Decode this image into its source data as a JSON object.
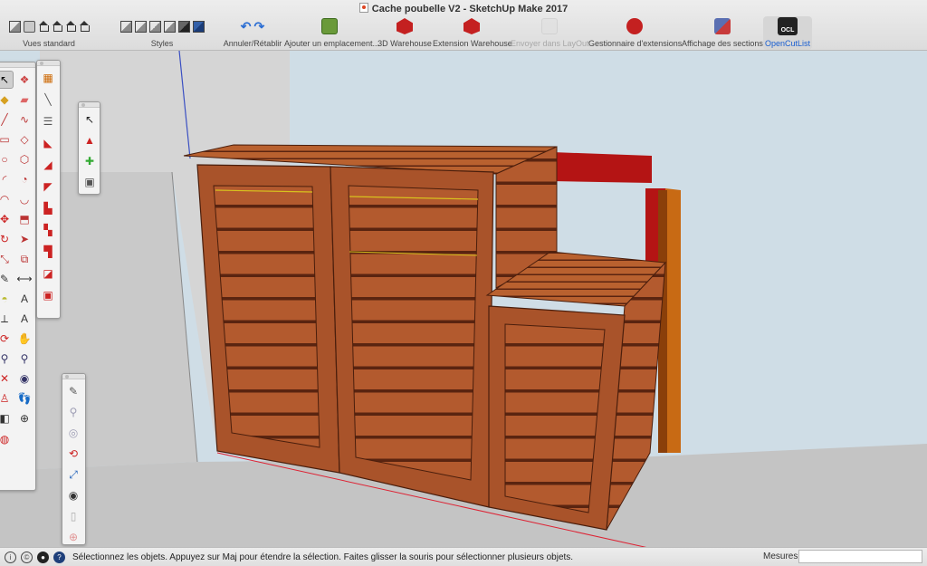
{
  "window": {
    "title": "Cache poubelle V2 - SketchUp Make 2017"
  },
  "toolbar": {
    "groups": [
      {
        "label": "Vues standard",
        "icons": [
          "iso-view-icon",
          "top-view-icon",
          "front-view-icon",
          "right-view-icon",
          "back-view-icon",
          "left-view-icon"
        ]
      },
      {
        "label": "Styles",
        "icons": [
          "xray-style-icon",
          "wireframe-style-icon",
          "hidden-line-style-icon",
          "shaded-style-icon",
          "shaded-textures-style-icon",
          "monochrome-style-icon"
        ]
      },
      {
        "label": "Annuler/Rétablir",
        "icons": [
          "undo-icon",
          "redo-icon"
        ]
      },
      {
        "label": "Ajouter un emplacement...",
        "icons": [
          "add-location-icon"
        ]
      },
      {
        "label": "3D Warehouse",
        "icons": [
          "3d-warehouse-icon"
        ]
      },
      {
        "label": "Extension Warehouse",
        "icons": [
          "extension-warehouse-icon"
        ]
      },
      {
        "label": "Envoyer dans LayOut",
        "icons": [
          "send-to-layout-icon"
        ],
        "disabled": true
      },
      {
        "label": "Gestionnaire d'extensions",
        "icons": [
          "extension-manager-icon"
        ]
      },
      {
        "label": "Affichage des sections",
        "icons": [
          "section-display-icon"
        ]
      },
      {
        "label": "OpenCutList",
        "icons": [
          "opencutlist-icon"
        ],
        "active": true
      }
    ]
  },
  "ocl_icon_text": "OCL",
  "palettes": {
    "large_tool_set": [
      "select-icon",
      "component-icon",
      "paint-bucket-icon",
      "eraser-icon",
      "line-icon",
      "freehand-icon",
      "rectangle-icon",
      "rotated-rectangle-icon",
      "circle-icon",
      "polygon-icon",
      "arc-icon",
      "pie-icon",
      "2pt-arc-icon",
      "3pt-arc-icon",
      "move-icon",
      "push-pull-icon",
      "rotate-icon",
      "follow-me-icon",
      "scale-icon",
      "offset-icon",
      "tape-measure-icon",
      "dimension-icon",
      "protractor-icon",
      "text-icon",
      "axes-icon",
      "3d-text-icon",
      "orbit-icon",
      "pan-icon",
      "zoom-icon",
      "zoom-window-icon",
      "zoom-extents-icon",
      "previous-view-icon",
      "position-camera-icon",
      "walk-icon",
      "look-around-icon",
      "section-plane-icon"
    ],
    "sandbox": [
      "from-contours-icon",
      "from-scratch-icon",
      "smoove-icon",
      "stamp-icon",
      "drape-icon",
      "add-detail-icon",
      "flip-edge-icon",
      "sandbox-tile-icon",
      "sandbox-box-icon",
      "sandbox-cut-icon",
      "sandbox-tag-icon"
    ],
    "small": [
      "select-arrow-icon",
      "warehouse-arrow-icon",
      "add-component-icon",
      "share-component-icon"
    ],
    "camera": [
      "orbit-camera-icon",
      "zoom-camera-icon",
      "walk-camera-icon",
      "position-camera-view-icon",
      "zoom-extents-camera-icon",
      "look-around-camera-icon",
      "section-camera-icon",
      "target-camera-icon"
    ]
  },
  "statusbar": {
    "message": "Sélectionnez les objets. Appuyez sur Maj pour étendre la sélection. Faites glisser la souris pour sélectionner plusieurs objets.",
    "measure_label": "Mesures",
    "measure_value": ""
  },
  "colors": {
    "wood": "#b35a2e",
    "wood_dark": "#7a3318",
    "ground": "#c4c4c4",
    "sky": "#cfdde6",
    "red_beam": "#b41414",
    "orange_post": "#c86a14",
    "active_blue": "#1a5fd1"
  }
}
